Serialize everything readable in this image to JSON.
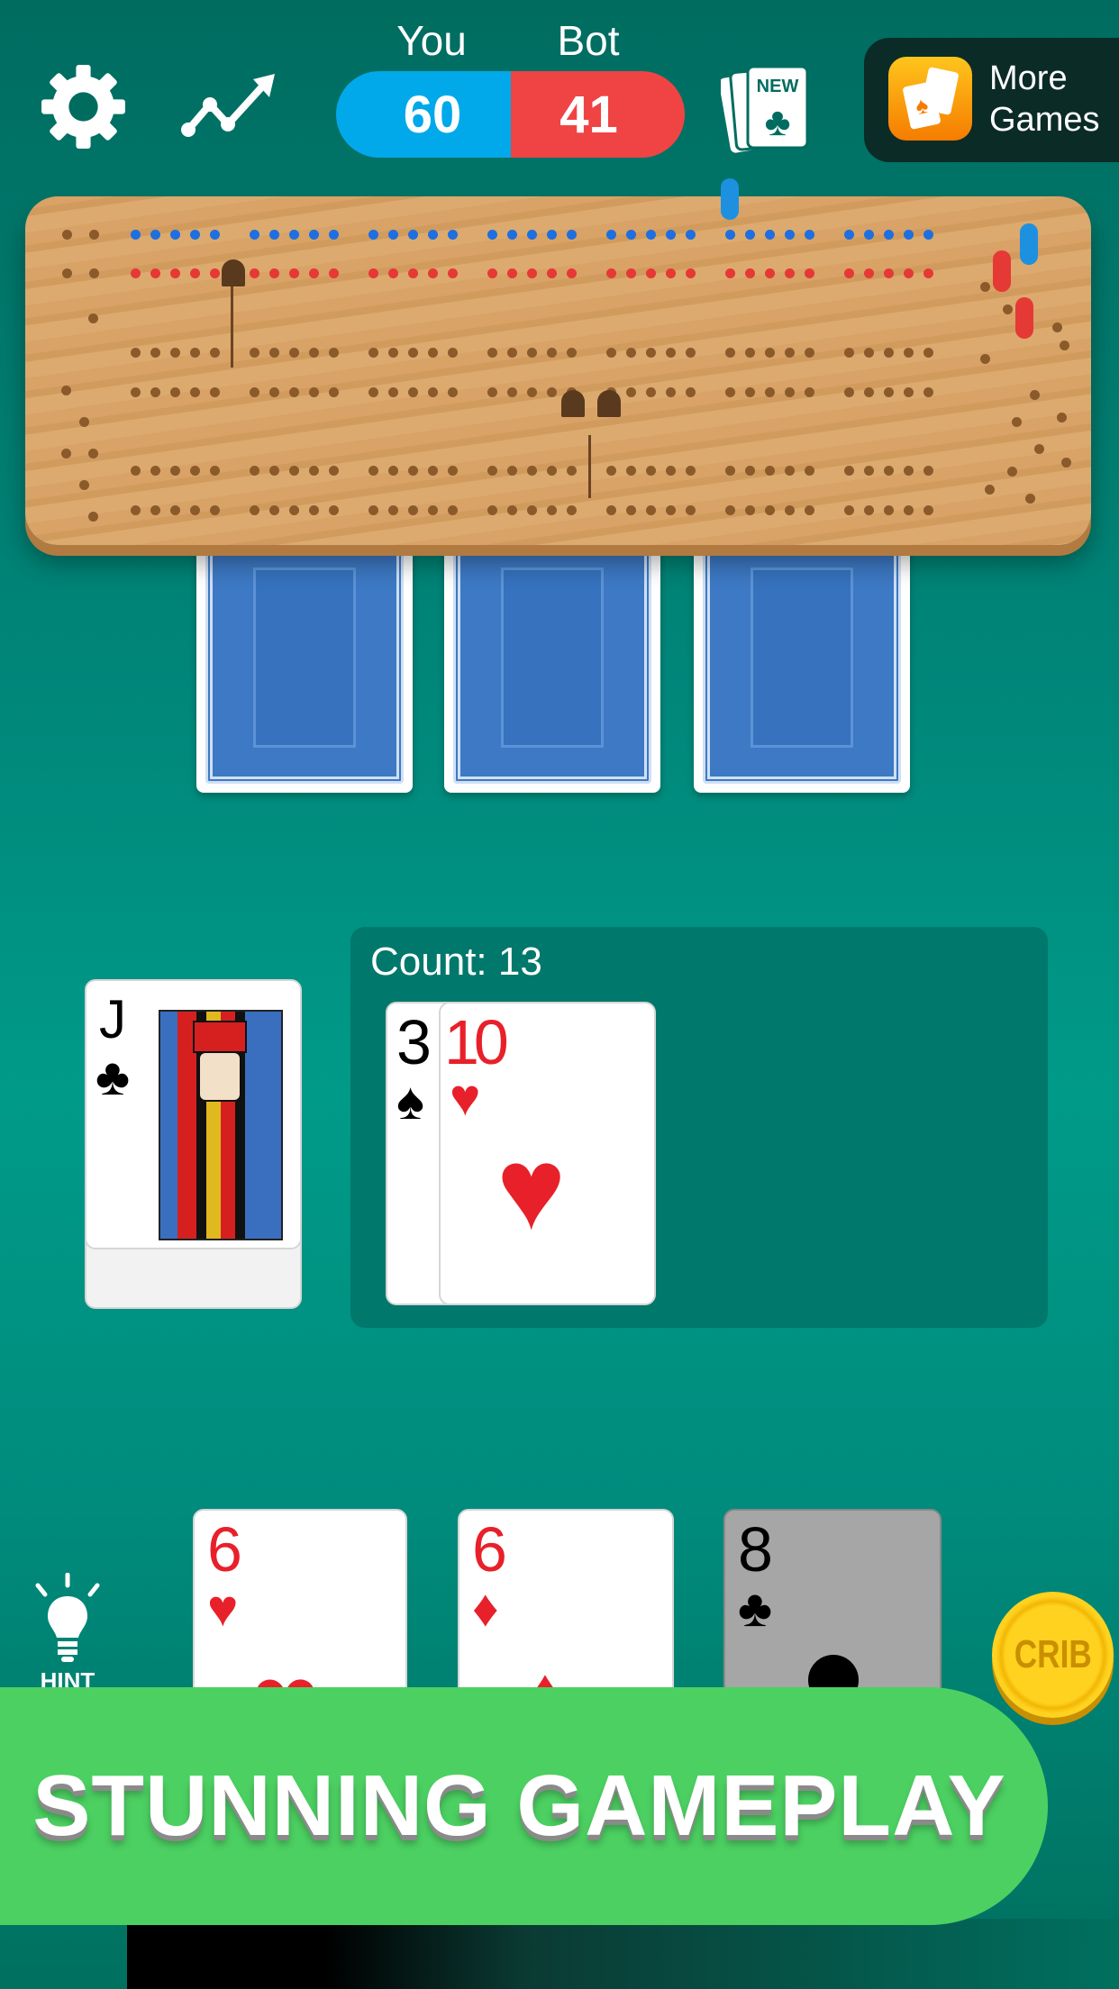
{
  "header": {
    "settings_icon": "gear-icon",
    "stats_icon": "trend-chart-icon",
    "new_game_icon": "new-cards-icon",
    "you_label": "You",
    "bot_label": "Bot",
    "you_score": "60",
    "bot_score": "41",
    "you_color": "#02a9ea",
    "bot_color": "#f04444",
    "more_games": {
      "line1": "More",
      "line2": "Games",
      "icon": "cards-app-icon"
    }
  },
  "board": {
    "rows": 6,
    "groups_per_row": 7,
    "holes_per_group": 5,
    "peg_colors": {
      "you": "#1e90e0",
      "bot": "#e53935"
    }
  },
  "bot_hand": {
    "count": 3,
    "face": "down"
  },
  "starter_card": {
    "rank": "J",
    "suit": "♣"
  },
  "play_area": {
    "count_label": "Count: 13",
    "played": [
      {
        "rank": "3",
        "suit": "♠",
        "color": "black"
      },
      {
        "rank": "10",
        "suit": "♥",
        "color": "red"
      }
    ]
  },
  "player_hand": [
    {
      "rank": "6",
      "suit": "♥",
      "color": "red"
    },
    {
      "rank": "6",
      "suit": "♦",
      "color": "red"
    },
    {
      "rank": "8",
      "suit": "♣",
      "color": "black",
      "disabled": true
    }
  ],
  "hint": {
    "label": "HINT",
    "icon": "lightbulb-icon"
  },
  "crib": {
    "label": "CRIB"
  },
  "banner": {
    "text": "STUNNING GAMEPLAY",
    "color": "#4cd062"
  }
}
